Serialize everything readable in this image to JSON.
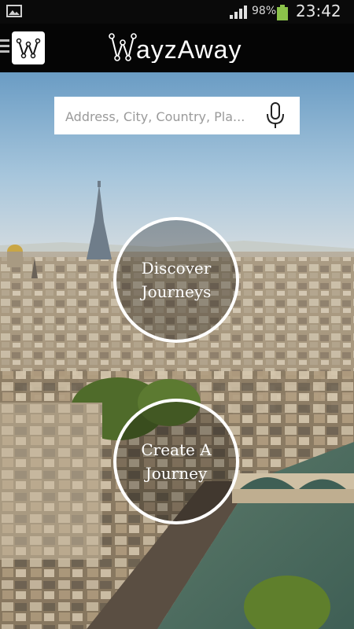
{
  "status_bar": {
    "battery_percent": "98%",
    "time": "23:42",
    "icons": [
      "image-icon",
      "signal-icon",
      "battery-icon"
    ]
  },
  "app_bar": {
    "logo_text": "WayzAway",
    "app_icon_letter": "W",
    "menu_icon": "hamburger-icon"
  },
  "search": {
    "placeholder": "Address, City, Country, Pla...",
    "mic_icon": "microphone-icon"
  },
  "actions": {
    "discover": {
      "line1": "Discover",
      "line2": "Journeys"
    },
    "create": {
      "line1": "Create A",
      "line2": "Journey"
    }
  },
  "colors": {
    "status_bar": "#0a0a0a",
    "app_bar": "#050505",
    "accent": "#ffffff"
  }
}
